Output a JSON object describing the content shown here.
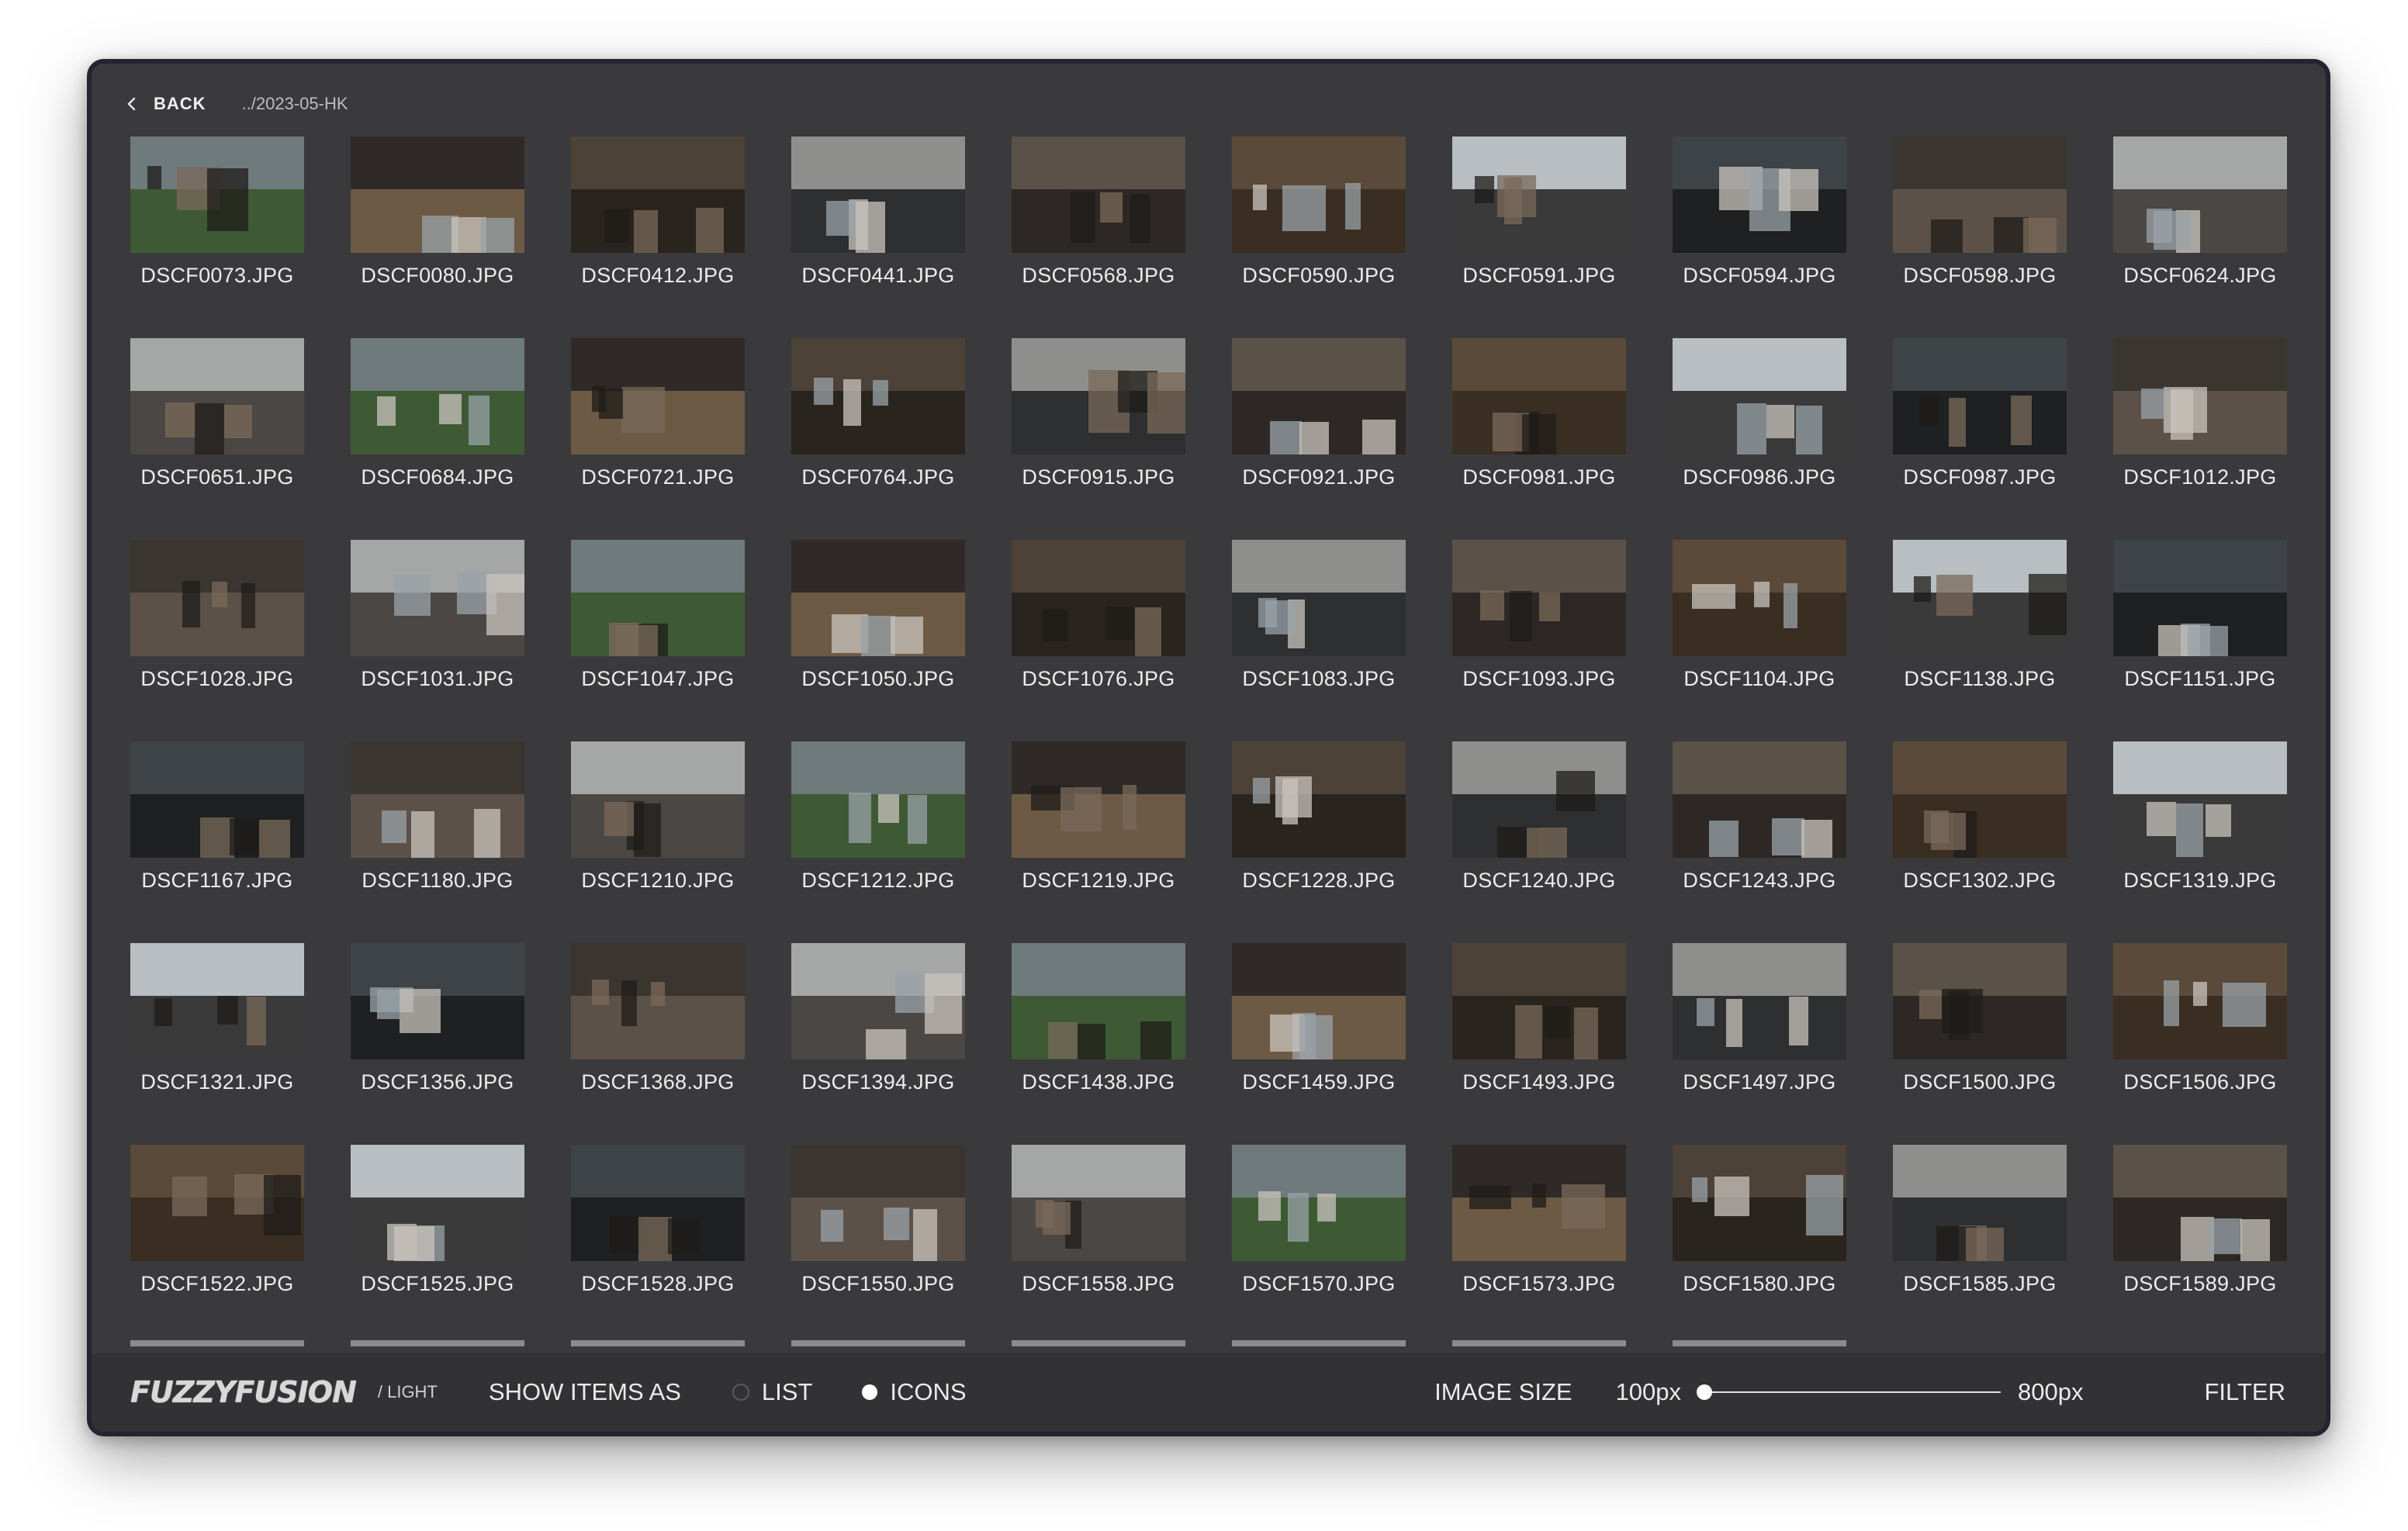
{
  "header": {
    "back_label": "BACK",
    "breadcrumb": "../2023-05-HK"
  },
  "files": [
    "DSCF0073.JPG",
    "DSCF0080.JPG",
    "DSCF0412.JPG",
    "DSCF0441.JPG",
    "DSCF0568.JPG",
    "DSCF0590.JPG",
    "DSCF0591.JPG",
    "DSCF0594.JPG",
    "DSCF0598.JPG",
    "DSCF0624.JPG",
    "DSCF0651.JPG",
    "DSCF0684.JPG",
    "DSCF0721.JPG",
    "DSCF0764.JPG",
    "DSCF0915.JPG",
    "DSCF0921.JPG",
    "DSCF0981.JPG",
    "DSCF0986.JPG",
    "DSCF0987.JPG",
    "DSCF1012.JPG",
    "DSCF1028.JPG",
    "DSCF1031.JPG",
    "DSCF1047.JPG",
    "DSCF1050.JPG",
    "DSCF1076.JPG",
    "DSCF1083.JPG",
    "DSCF1093.JPG",
    "DSCF1104.JPG",
    "DSCF1138.JPG",
    "DSCF1151.JPG",
    "DSCF1167.JPG",
    "DSCF1180.JPG",
    "DSCF1210.JPG",
    "DSCF1212.JPG",
    "DSCF1219.JPG",
    "DSCF1228.JPG",
    "DSCF1240.JPG",
    "DSCF1243.JPG",
    "DSCF1302.JPG",
    "DSCF1319.JPG",
    "DSCF1321.JPG",
    "DSCF1356.JPG",
    "DSCF1368.JPG",
    "DSCF1394.JPG",
    "DSCF1438.JPG",
    "DSCF1459.JPG",
    "DSCF1493.JPG",
    "DSCF1497.JPG",
    "DSCF1500.JPG",
    "DSCF1506.JPG",
    "DSCF1522.JPG",
    "DSCF1525.JPG",
    "DSCF1528.JPG",
    "DSCF1550.JPG",
    "DSCF1558.JPG",
    "DSCF1570.JPG",
    "DSCF1573.JPG",
    "DSCF1580.JPG",
    "DSCF1585.JPG",
    "DSCF1589.JPG"
  ],
  "footer": {
    "logo": "FUZZYFUSION",
    "theme_toggle": "/ LIGHT",
    "show_items_label": "SHOW ITEMS AS",
    "option_list": "LIST",
    "option_icons": "ICONS",
    "selected_view": "ICONS",
    "image_size_label": "IMAGE SIZE",
    "size_min": "100px",
    "size_max": "800px",
    "size_value_fraction": 0,
    "filter_label": "FILTER"
  },
  "colors": {
    "background": "#3a3a3c",
    "window_border": "#272232",
    "footer": "#323234",
    "text": "#ececec"
  }
}
